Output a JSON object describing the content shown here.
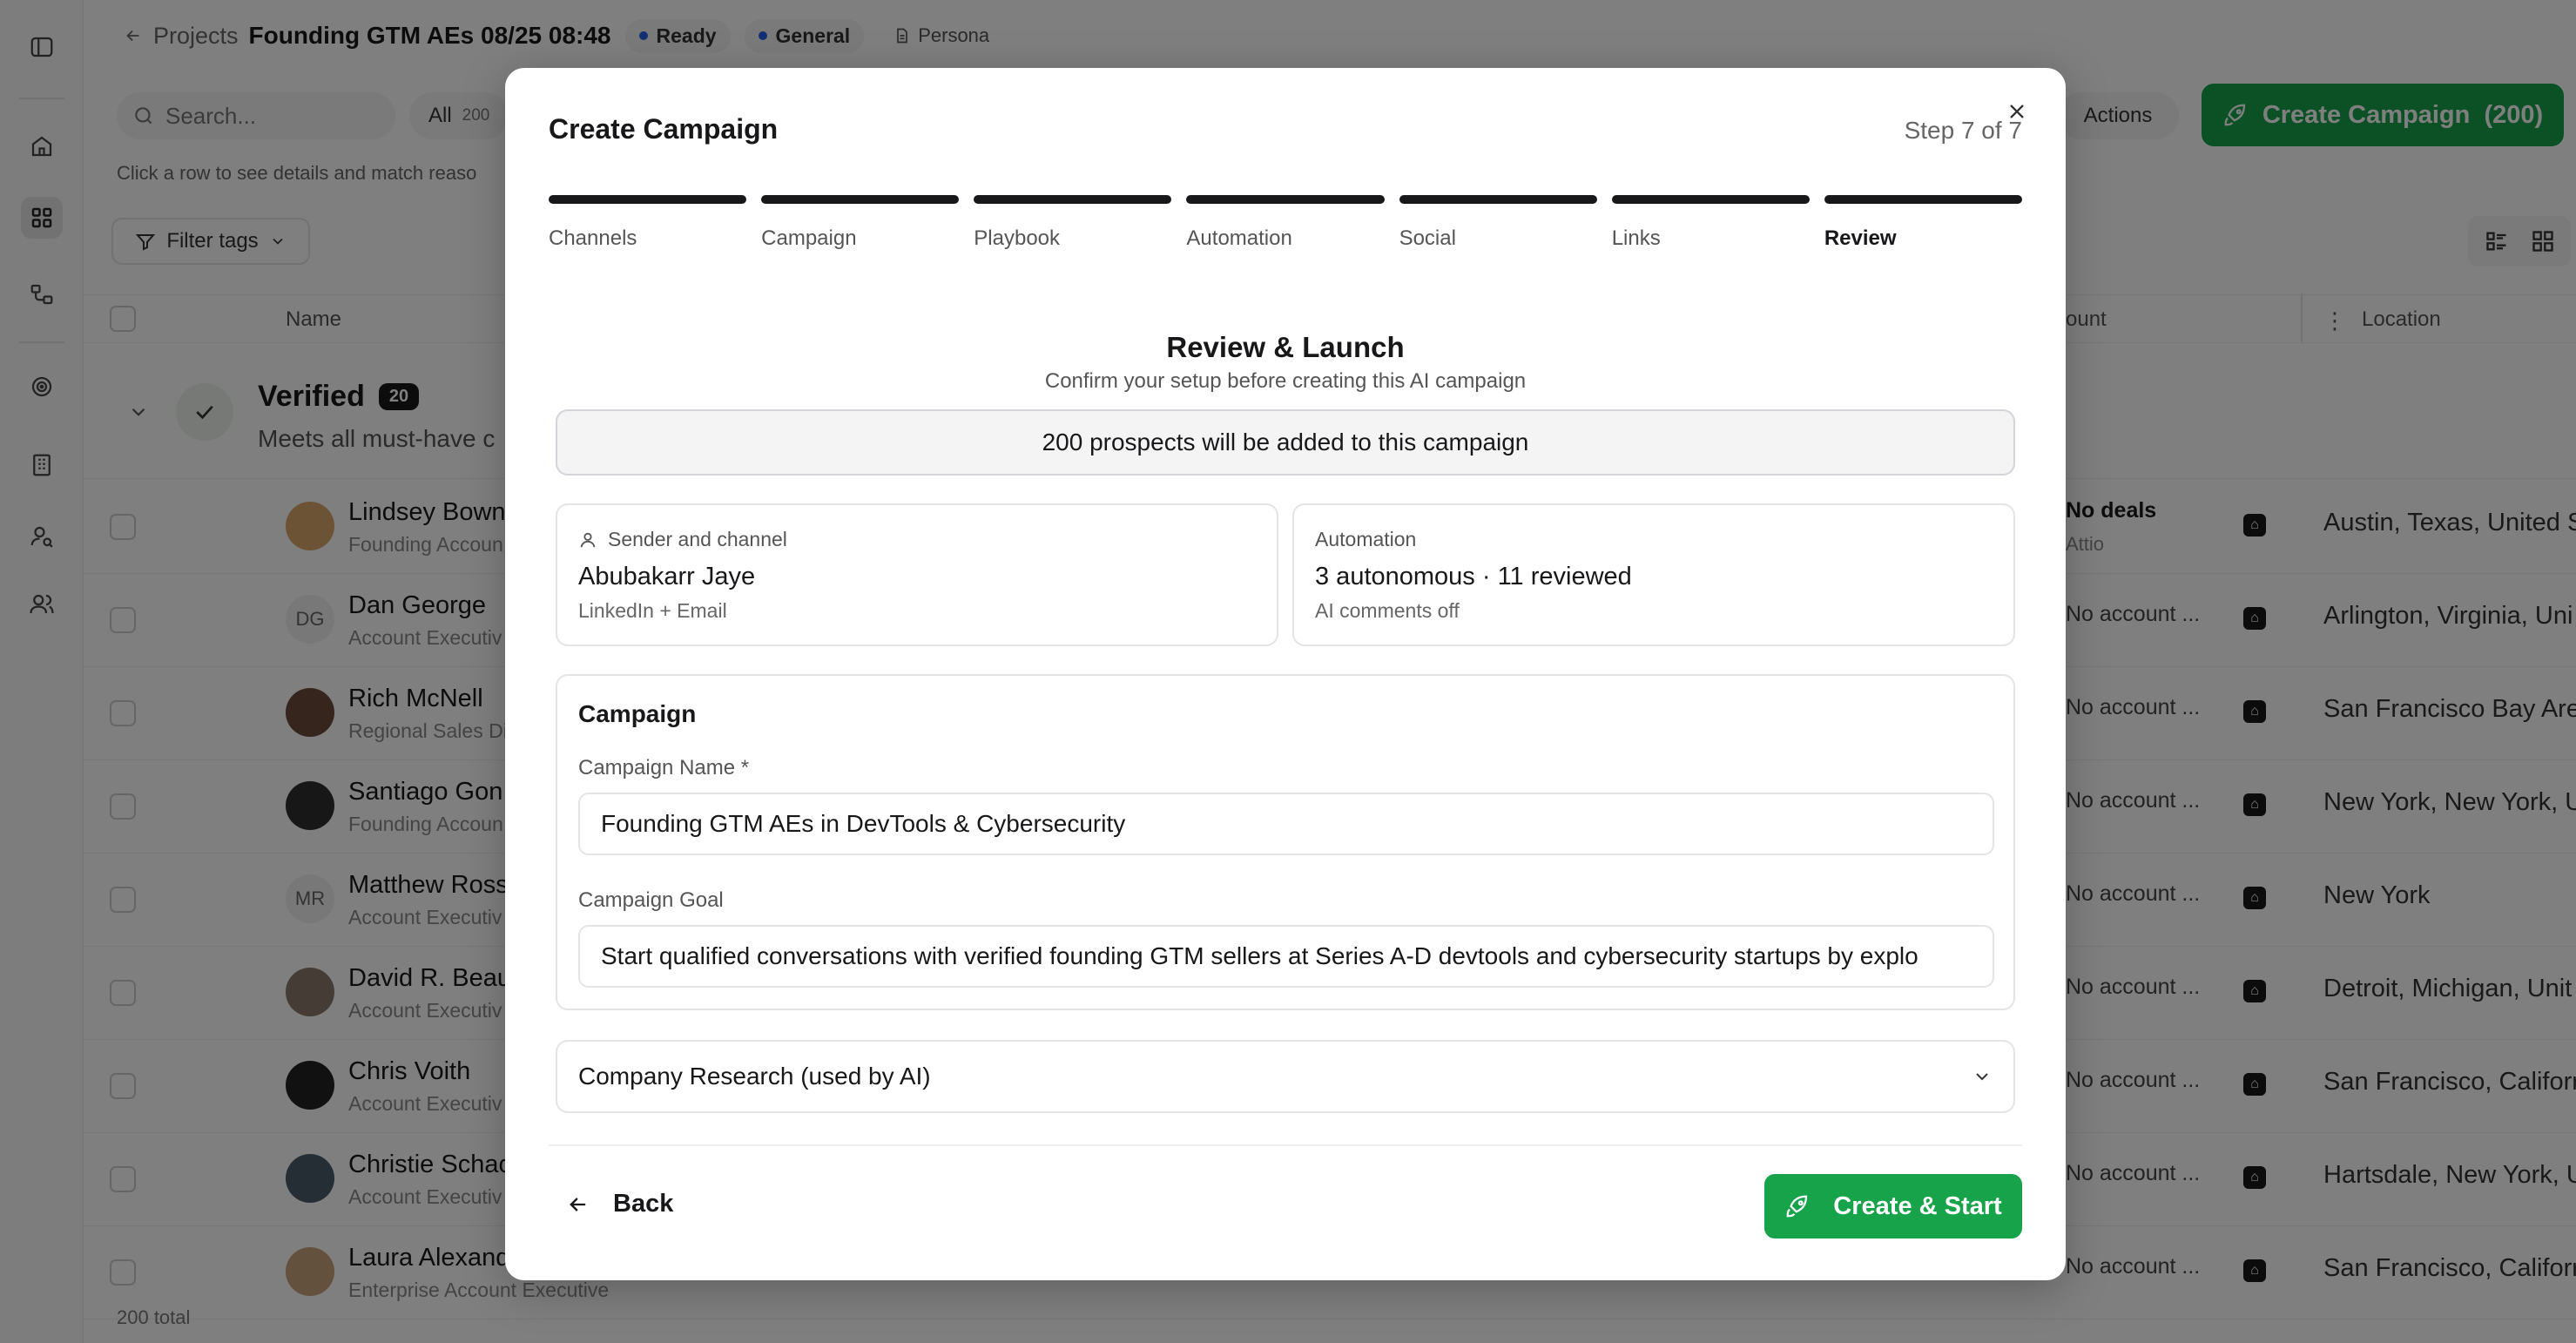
{
  "header": {
    "back_label": "Projects",
    "project_title": "Founding GTM AEs 08/25 08:48",
    "status_badge": "Ready",
    "type_badge": "General",
    "persona_label": "Persona"
  },
  "toolbar": {
    "search_placeholder": "Search...",
    "all_label": "All",
    "all_count": "200",
    "hint": "Click a row to see details and match reaso",
    "actions_label": "Actions",
    "create_campaign_label": "Create Campaign  (200)",
    "filter_tags_label": "Filter tags"
  },
  "table": {
    "columns": {
      "name": "Name",
      "account": "ount",
      "location": "Location"
    },
    "group": {
      "title": "Verified",
      "count": "20",
      "subtitle": "Meets all must-have c"
    },
    "rows": [
      {
        "name": "Lindsey Bown",
        "title": "Founding Accoun",
        "initials": "",
        "account": "No deals",
        "account_source": "Attio",
        "location": "Austin, Texas, United S"
      },
      {
        "name": "Dan George",
        "title": "Account Executiv",
        "initials": "DG",
        "account": "No account ...",
        "account_source": "",
        "location": "Arlington, Virginia, Uni"
      },
      {
        "name": "Rich McNell",
        "title": "Regional Sales Di",
        "initials": "",
        "account": "No account ...",
        "account_source": "",
        "location": "San Francisco Bay Are"
      },
      {
        "name": "Santiago Gon",
        "title": "Founding Accoun",
        "initials": "",
        "account": "No account ...",
        "account_source": "",
        "location": "New York, New York, U"
      },
      {
        "name": "Matthew Ross",
        "title": "Account Executiv",
        "initials": "MR",
        "account": "No account ...",
        "account_source": "",
        "location": "New York"
      },
      {
        "name": "David R. Beau",
        "title": "Account Executiv",
        "initials": "",
        "account": "No account ...",
        "account_source": "",
        "location": "Detroit, Michigan, Unit"
      },
      {
        "name": "Chris Voith",
        "title": "Account Executiv",
        "initials": "",
        "account": "No account ...",
        "account_source": "",
        "location": "San Francisco, Califorr"
      },
      {
        "name": "Christie Schac",
        "title": "Account Executiv",
        "initials": "",
        "account": "No account ...",
        "account_source": "",
        "location": "Hartsdale, New York, U"
      },
      {
        "name": "Laura Alexand",
        "title": "Enterprise Account Executive",
        "initials": "",
        "account": "No account ...",
        "account_source": "",
        "location": "San Francisco, Califorr"
      }
    ],
    "footer_total": "200 total"
  },
  "modal": {
    "title": "Create Campaign",
    "step_indicator": "Step 7 of 7",
    "steps": [
      "Channels",
      "Campaign",
      "Playbook",
      "Automation",
      "Social",
      "Links",
      "Review"
    ],
    "current_step": "Review",
    "review_title": "Review & Launch",
    "review_subtitle": "Confirm your setup before creating this AI campaign",
    "banner": "200 prospects will be added to this campaign",
    "sender_card": {
      "header": "Sender and channel",
      "value": "Abubakarr Jaye",
      "sub": "LinkedIn + Email"
    },
    "automation_card": {
      "header": "Automation",
      "value": "3 autonomous · 11 reviewed",
      "sub": "AI comments off"
    },
    "campaign_section": {
      "header": "Campaign",
      "name_label": "Campaign Name *",
      "name_value": "Founding GTM AEs in DevTools & Cybersecurity",
      "goal_label": "Campaign Goal",
      "goal_value": "Start qualified conversations with verified founding GTM sellers at Series A-D devtools and cybersecurity startups by explo"
    },
    "research_label": "Company Research (used by AI)",
    "back_label": "Back",
    "create_label": "Create & Start"
  },
  "colors": {
    "accent": "#16a34a",
    "badge_dot": "#2563eb",
    "overlay": "rgba(0,0,0,0.5)"
  }
}
